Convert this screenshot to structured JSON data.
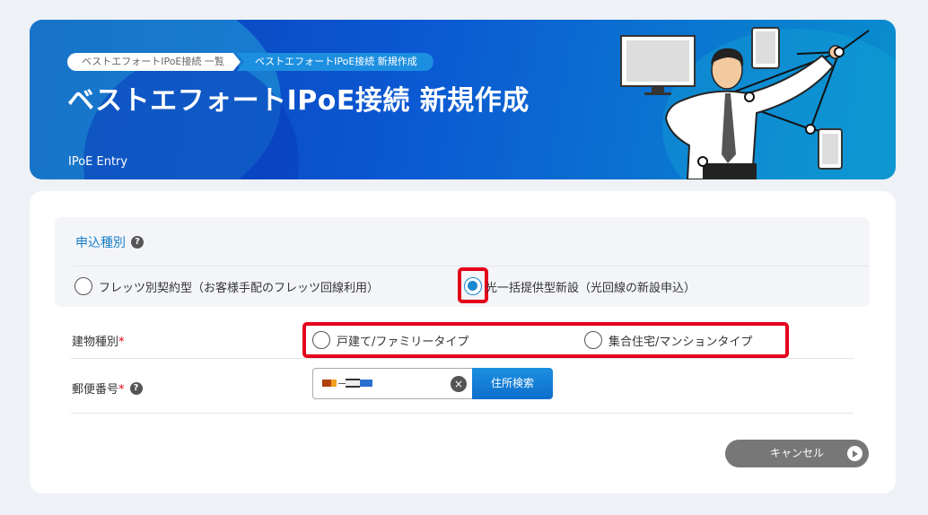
{
  "breadcrumb": {
    "items": [
      "ベストエフォートIPoE接続 一覧",
      "ベストエフォートIPoE接続 新規作成"
    ]
  },
  "hero": {
    "title": "ベストエフォートIPoE接続 新規作成",
    "subtitle": "IPoE Entry"
  },
  "apply_type": {
    "label": "申込種別",
    "help": "?",
    "options": [
      {
        "label": "フレッツ別契約型（お客様手配のフレッツ回線利用）",
        "checked": false
      },
      {
        "label": "光一括提供型新設（光回線の新設申込）",
        "checked": true
      }
    ]
  },
  "building_type": {
    "label": "建物種別",
    "required_mark": "*",
    "options": [
      {
        "label": "戸建て/ファミリータイプ",
        "checked": false
      },
      {
        "label": "集合住宅/マンションタイプ",
        "checked": false
      }
    ]
  },
  "postal_code": {
    "label": "郵便番号",
    "required_mark": "*",
    "help": "?",
    "clear_icon": "×",
    "search_button": "住所検索"
  },
  "actions": {
    "cancel_button": "キャンセル"
  },
  "colors": {
    "accent": "#1a8ad2",
    "highlight": "#e4001b",
    "hero_from": "#0a3fb8",
    "hero_to": "#0a8fce"
  }
}
